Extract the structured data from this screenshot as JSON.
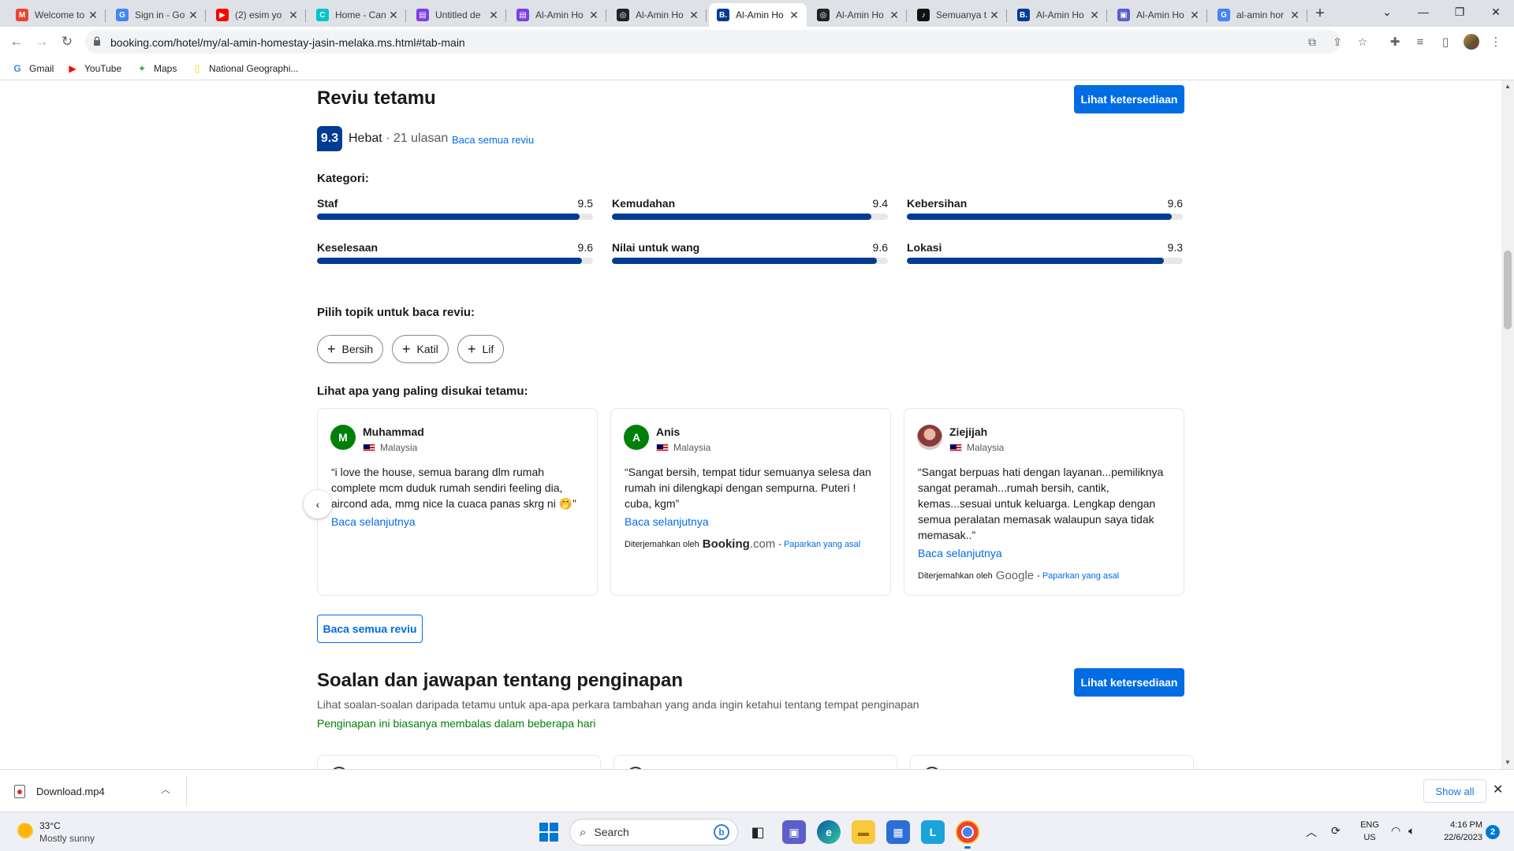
{
  "browser": {
    "tabs": [
      {
        "title": "Welcome to",
        "favicon": "gmail-icon",
        "color": "#ea4335",
        "glyph": "M"
      },
      {
        "title": "Sign in - Go",
        "favicon": "google-icon",
        "color": "#4285f4",
        "glyph": "G"
      },
      {
        "title": "(2) esim yo",
        "favicon": "youtube-icon",
        "color": "#ff0000",
        "glyph": "▶"
      },
      {
        "title": "Home - Can",
        "favicon": "canva-icon",
        "color": "#00c4cc",
        "glyph": "C"
      },
      {
        "title": "Untitled de",
        "favicon": "doc-icon",
        "color": "#7b3fe4",
        "glyph": "▤"
      },
      {
        "title": "Al-Amin Ho",
        "favicon": "doc-icon",
        "color": "#7b3fe4",
        "glyph": "▤"
      },
      {
        "title": "Al-Amin Ho",
        "favicon": "chatgpt-icon",
        "color": "#202124",
        "glyph": "◎"
      },
      {
        "title": "Al-Amin Ho",
        "favicon": "booking-icon",
        "color": "#003b95",
        "glyph": "B."
      },
      {
        "title": "Al-Amin Ho",
        "favicon": "chatgpt-icon",
        "color": "#202124",
        "glyph": "◎"
      },
      {
        "title": "Semuanya t",
        "favicon": "tiktok-icon",
        "color": "#111111",
        "glyph": "♪"
      },
      {
        "title": "Al-Amin Ho",
        "favicon": "booking-icon",
        "color": "#003b95",
        "glyph": "B."
      },
      {
        "title": "Al-Amin Ho",
        "favicon": "teams-icon",
        "color": "#5b5fc7",
        "glyph": "▣"
      },
      {
        "title": "al-amin hor",
        "favicon": "google-icon",
        "color": "#4285f4",
        "glyph": "G"
      }
    ],
    "active_tab": 7,
    "url": "booking.com/hotel/my/al-amin-homestay-jasin-melaka.ms.html#tab-main",
    "bookmarks": [
      {
        "label": "Gmail",
        "icon": "google-icon",
        "color": "#4285f4",
        "glyph": "G"
      },
      {
        "label": "YouTube",
        "icon": "youtube-icon",
        "color": "#ff0000",
        "glyph": "▶"
      },
      {
        "label": "Maps",
        "icon": "maps-icon",
        "color": "#34a853",
        "glyph": "✦"
      },
      {
        "label": "National Geographi...",
        "icon": "natgeo-icon",
        "color": "#ffce00",
        "glyph": "▯"
      }
    ]
  },
  "reviews": {
    "heading": "Reviu tetamu",
    "cta": "Lihat ketersediaan",
    "score": "9.3",
    "rating_word": "Hebat",
    "separator": " · ",
    "count_label": "21 ulasan",
    "read_all_link": "Baca semua reviu",
    "categories_label": "Kategori:",
    "categories": [
      {
        "name": "Staf",
        "value": "9.5",
        "score": 9.5
      },
      {
        "name": "Kemudahan",
        "value": "9.4",
        "score": 9.4
      },
      {
        "name": "Kebersihan",
        "value": "9.6",
        "score": 9.6
      },
      {
        "name": "Keselesaan",
        "value": "9.6",
        "score": 9.6
      },
      {
        "name": "Nilai untuk wang",
        "value": "9.6",
        "score": 9.6
      },
      {
        "name": "Lokasi",
        "value": "9.3",
        "score": 9.3
      }
    ],
    "topics_label": "Pilih topik untuk baca reviu:",
    "topics": [
      "Bersih",
      "Katil",
      "Lif"
    ],
    "liked_label": "Lihat apa yang paling disukai tetamu:",
    "cards": [
      {
        "initial": "M",
        "name": "Muhammad",
        "country": "Malaysia",
        "text": "“i love the house, semua barang dlm rumah complete mcm duduk rumah sendiri feeling dia, aircond ada, mmg nice la cuaca panas skrg ni 🤭”",
        "more": "Baca selanjutnya"
      },
      {
        "initial": "A",
        "name": "Anis",
        "country": "Malaysia",
        "text": "“Sangat bersih, tempat tidur semuanya selesa dan rumah ini dilengkapi dengan sempurna. Puteri ! cuba, kgm”",
        "more": "Baca selanjutnya",
        "translated_by": "Diterjemahkan oleh",
        "brand_main": "Booking",
        "brand_suffix": ".com",
        "dash": " - ",
        "show_original": "Paparkan yang asal"
      },
      {
        "initial": "",
        "name": "Ziejijah",
        "country": "Malaysia",
        "text": "“Sangat berpuas hati dengan layanan...pemiliknya sangat peramah...rumah bersih, cantik, kemas...sesuai untuk keluarga. Lengkap dengan semua peralatan memasak walaupun saya tidak memasak..”",
        "more": "Baca selanjutnya",
        "translated_by": "Diterjemahkan oleh",
        "brand_main": "Google",
        "dash": " - ",
        "show_original": "Paparkan yang asal"
      }
    ],
    "read_all_button": "Baca semua reviu"
  },
  "qa": {
    "heading": "Soalan dan jawapan tentang penginapan",
    "cta": "Lihat ketersediaan",
    "subtitle": "Lihat soalan-soalan daripada tetamu untuk apa-apa perkara tambahan yang anda ingin ketahui tentang tempat penginapan",
    "response_note": "Penginapan ini biasanya membalas dalam beberapa hari"
  },
  "download": {
    "filename": "Download.mp4",
    "show_all": "Show all"
  },
  "taskbar": {
    "temp": "33°C",
    "weather": "Mostly sunny",
    "search": "Search",
    "lang_top": "ENG",
    "lang_bottom": "US",
    "time": "4:16 PM",
    "date": "22/6/2023",
    "notifications": "2",
    "colors": {
      "accent": "#0078d4"
    }
  },
  "colors": {
    "booking_blue": "#006ce4",
    "booking_dark": "#003b95",
    "green": "#008009"
  }
}
